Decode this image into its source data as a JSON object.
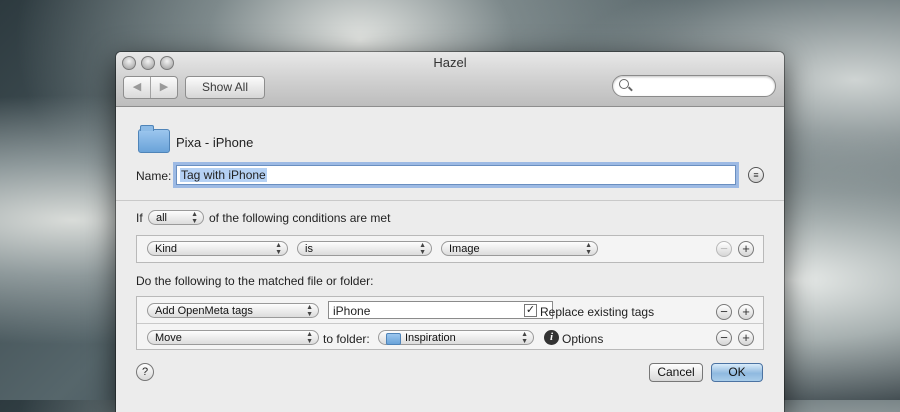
{
  "window": {
    "title": "Hazel"
  },
  "toolbar": {
    "back": "◀",
    "forward": "▶",
    "show_all": "Show All",
    "search_placeholder": ""
  },
  "folder": {
    "name": "Pixa - iPhone"
  },
  "rule": {
    "name_label": "Name:",
    "name_value": "Tag with iPhone",
    "if_label": "If",
    "match_value": "all",
    "conditions_text": "of the following conditions are met",
    "conditions": [
      {
        "attribute": "Kind",
        "operator": "is",
        "value": "Image"
      }
    ],
    "actions_label": "Do the following to the matched file or folder:",
    "actions": [
      {
        "action": "Add OpenMeta tags",
        "tag_value": "iPhone",
        "replace_checked": true,
        "replace_label": "Replace existing tags"
      },
      {
        "action": "Move",
        "to_folder_label": "to folder:",
        "folder": "Inspiration",
        "options_label": "Options"
      }
    ]
  },
  "buttons": {
    "help": "?",
    "cancel": "Cancel",
    "ok": "OK"
  },
  "symbols": {
    "minus": "−",
    "plus": "+",
    "doc": "≡",
    "info": "i",
    "check": "✓"
  }
}
